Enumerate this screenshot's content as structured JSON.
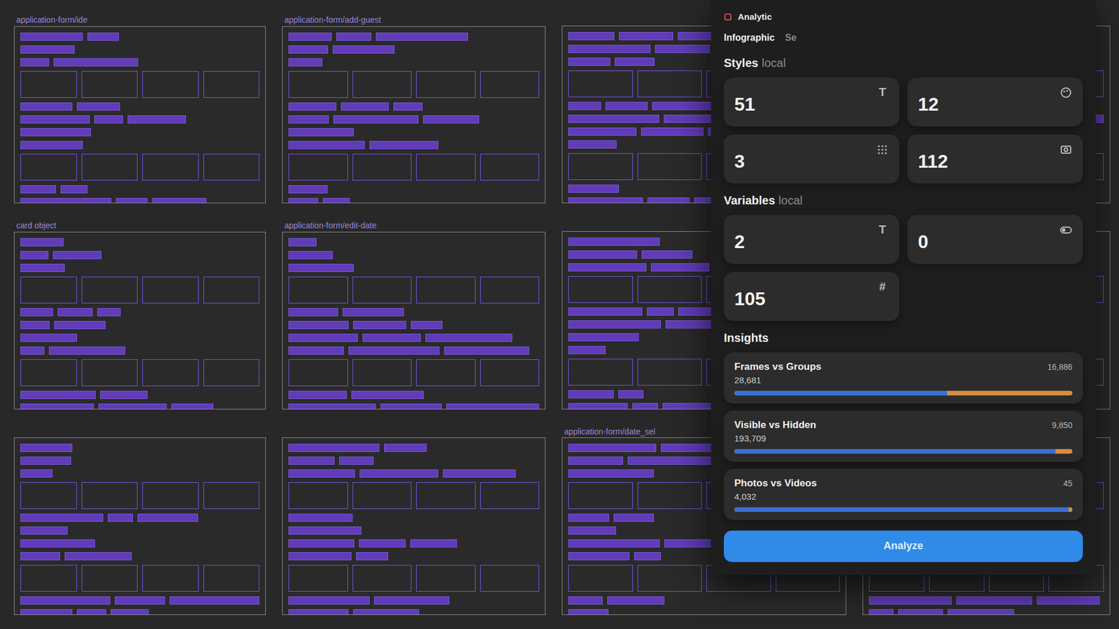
{
  "plugin": {
    "title": "Analytic",
    "tabs": [
      {
        "label": "Infographic",
        "selected": true
      },
      {
        "label": "Se",
        "selected": false
      }
    ]
  },
  "styles": {
    "title": "Styles",
    "scope": "local",
    "cards": [
      {
        "value": "51",
        "kind": "text",
        "icon": "T"
      },
      {
        "value": "12",
        "kind": "color",
        "icon": ""
      },
      {
        "value": "3",
        "kind": "grid",
        "icon": ""
      },
      {
        "value": "112",
        "kind": "effect",
        "icon": ""
      }
    ]
  },
  "variables": {
    "title": "Variables",
    "scope": "local",
    "cards": [
      {
        "value": "2",
        "kind": "string",
        "icon": "T"
      },
      {
        "value": "0",
        "kind": "boolean",
        "icon": ""
      },
      {
        "value": "105",
        "kind": "number",
        "icon": "#"
      }
    ]
  },
  "insights": {
    "title": "Insights",
    "items": [
      {
        "label": "Frames vs Groups",
        "left": "28,681",
        "right": "16,886",
        "level": 0.63
      },
      {
        "label": "Visible vs Hidden",
        "left": "193,709",
        "right": "9,850",
        "level": 0.95
      },
      {
        "label": "Photos vs Videos",
        "left": "4,032",
        "right": "45",
        "level": 0.99
      }
    ]
  },
  "button": "Analyze",
  "canvas": {
    "frames": [
      {
        "label": "application-form/ide"
      },
      {
        "label": "application-form/add-guest"
      },
      {
        "label": ""
      },
      {
        "label": ""
      },
      {
        "label": "card object"
      },
      {
        "label": "application-form/edit-date"
      },
      {
        "label": ""
      },
      {
        "label": ""
      },
      {
        "label": ""
      },
      {
        "label": ""
      },
      {
        "label": "application-form/date_sel"
      },
      {
        "label": ""
      }
    ]
  }
}
